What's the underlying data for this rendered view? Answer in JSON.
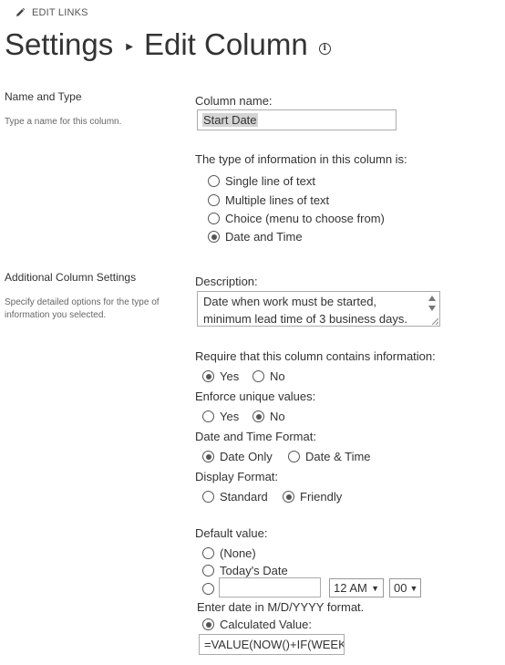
{
  "header": {
    "edit_links_label": "EDIT LINKS",
    "title_part1": "Settings",
    "title_part2": "Edit Column"
  },
  "name_type": {
    "section_title": "Name and Type",
    "section_desc": "Type a name for this column.",
    "column_name_label": "Column name:",
    "column_name_value": "Start Date",
    "type_label": "The type of information in this column is:",
    "type_options": [
      {
        "label": "Single line of text",
        "checked": false
      },
      {
        "label": "Multiple lines of text",
        "checked": false
      },
      {
        "label": "Choice (menu to choose from)",
        "checked": false
      },
      {
        "label": "Date and Time",
        "checked": true
      }
    ]
  },
  "additional": {
    "section_title": "Additional Column Settings",
    "section_desc": "Specify detailed options for the type of information you selected.",
    "description_label": "Description:",
    "description_value": "Date when work must be started, minimum lead time of 3 business days.",
    "require_label": "Require that this column contains information:",
    "require_yes": "Yes",
    "require_no": "No",
    "unique_label": "Enforce unique values:",
    "unique_yes": "Yes",
    "unique_no": "No",
    "format_label": "Date and Time Format:",
    "format_date_only": "Date Only",
    "format_date_time": "Date & Time",
    "display_label": "Display Format:",
    "display_standard": "Standard",
    "display_friendly": "Friendly",
    "default_label": "Default value:",
    "default_none": "(None)",
    "default_today": "Today's Date",
    "default_date_value": "",
    "hour_value": "12 AM",
    "minute_value": "00",
    "date_hint": "Enter date in M/D/YYYY format.",
    "calculated_label": "Calculated Value:",
    "calculated_value": "=VALUE(NOW()+IF(WEEKI"
  }
}
